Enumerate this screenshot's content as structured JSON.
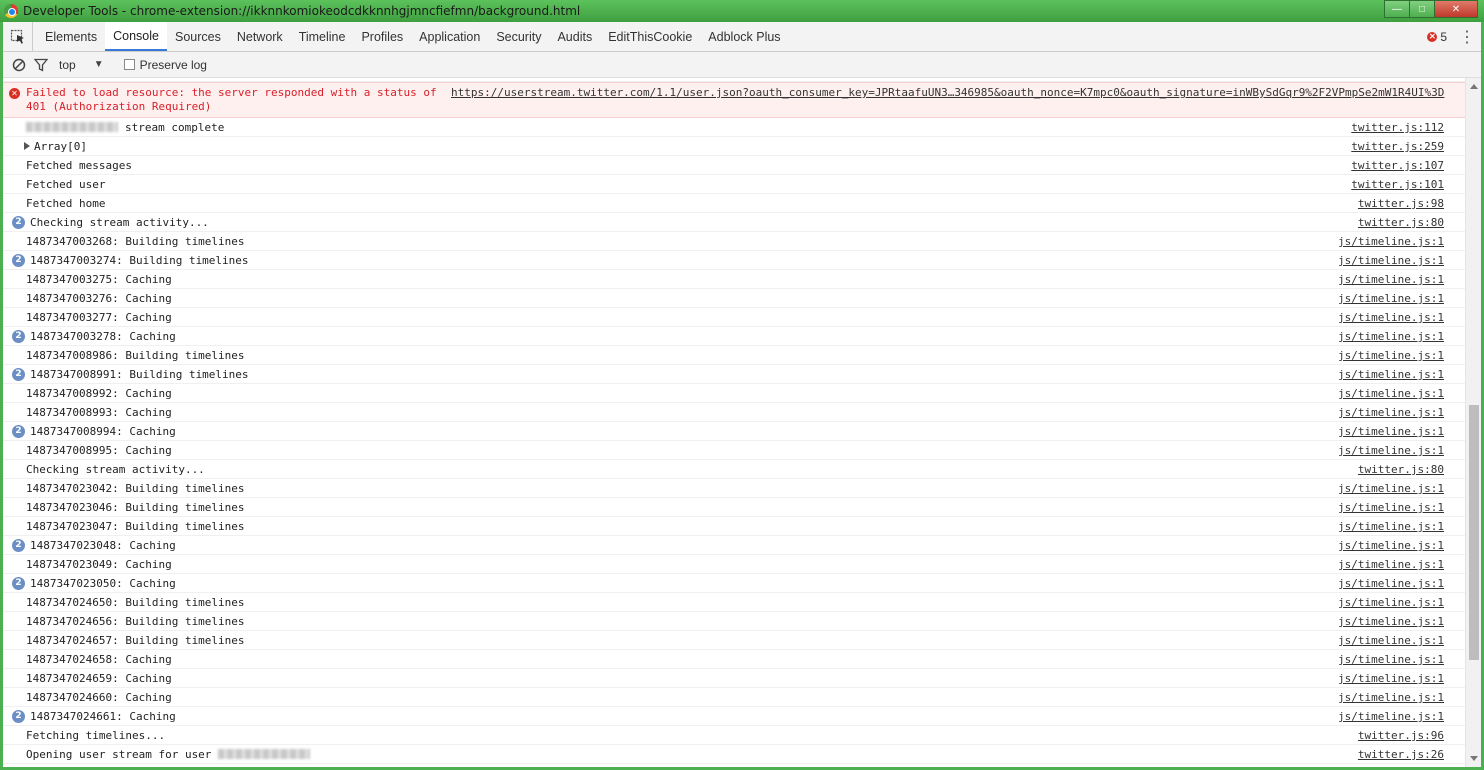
{
  "window": {
    "title": "Developer Tools - chrome-extension://ikknnkomiokeodcdkknnhgjmncfiefmn/background.html"
  },
  "tabs": [
    "Elements",
    "Console",
    "Sources",
    "Network",
    "Timeline",
    "Profiles",
    "Application",
    "Security",
    "Audits",
    "EditThisCookie",
    "Adblock Plus"
  ],
  "active_tab": "Console",
  "error_count": "5",
  "toolbar": {
    "context": "top",
    "preserve_log_label": "Preserve log",
    "preserve_log_checked": false
  },
  "console": {
    "error": {
      "message": "Failed to load resource: the server responded with a status of 401 (Authorization Required)",
      "url": "https://userstream.twitter.com/1.1/user.json?oauth_consumer_key=JPRtaafuUN3…346985&oauth_nonce=K7mpc0&oauth_signature=inWBySdGqr9%2F2VPmpSe2mW1R4UI%3D"
    },
    "rows": [
      {
        "text": "stream complete",
        "src": "twitter.js:112",
        "redacted_prefix": true
      },
      {
        "text": "Array[0]",
        "src": "twitter.js:259",
        "expandable": true
      },
      {
        "text": "Fetched messages",
        "src": "twitter.js:107"
      },
      {
        "text": "Fetched user",
        "src": "twitter.js:101"
      },
      {
        "text": "Fetched home",
        "src": "twitter.js:98"
      },
      {
        "text": "Checking stream activity...",
        "src": "twitter.js:80",
        "count": "2"
      },
      {
        "text": "1487347003268: Building timelines",
        "src": "js/timeline.js:1"
      },
      {
        "text": "1487347003274: Building timelines",
        "src": "js/timeline.js:1",
        "count": "2"
      },
      {
        "text": "1487347003275: Caching",
        "src": "js/timeline.js:1"
      },
      {
        "text": "1487347003276: Caching",
        "src": "js/timeline.js:1"
      },
      {
        "text": "1487347003277: Caching",
        "src": "js/timeline.js:1"
      },
      {
        "text": "1487347003278: Caching",
        "src": "js/timeline.js:1",
        "count": "2"
      },
      {
        "text": "1487347008986: Building timelines",
        "src": "js/timeline.js:1"
      },
      {
        "text": "1487347008991: Building timelines",
        "src": "js/timeline.js:1",
        "count": "2"
      },
      {
        "text": "1487347008992: Caching",
        "src": "js/timeline.js:1"
      },
      {
        "text": "1487347008993: Caching",
        "src": "js/timeline.js:1"
      },
      {
        "text": "1487347008994: Caching",
        "src": "js/timeline.js:1",
        "count": "2"
      },
      {
        "text": "1487347008995: Caching",
        "src": "js/timeline.js:1"
      },
      {
        "text": "Checking stream activity...",
        "src": "twitter.js:80"
      },
      {
        "text": "1487347023042: Building timelines",
        "src": "js/timeline.js:1"
      },
      {
        "text": "1487347023046: Building timelines",
        "src": "js/timeline.js:1"
      },
      {
        "text": "1487347023047: Building timelines",
        "src": "js/timeline.js:1"
      },
      {
        "text": "1487347023048: Caching",
        "src": "js/timeline.js:1",
        "count": "2"
      },
      {
        "text": "1487347023049: Caching",
        "src": "js/timeline.js:1"
      },
      {
        "text": "1487347023050: Caching",
        "src": "js/timeline.js:1",
        "count": "2"
      },
      {
        "text": "1487347024650: Building timelines",
        "src": "js/timeline.js:1"
      },
      {
        "text": "1487347024656: Building timelines",
        "src": "js/timeline.js:1"
      },
      {
        "text": "1487347024657: Building timelines",
        "src": "js/timeline.js:1"
      },
      {
        "text": "1487347024658: Caching",
        "src": "js/timeline.js:1"
      },
      {
        "text": "1487347024659: Caching",
        "src": "js/timeline.js:1"
      },
      {
        "text": "1487347024660: Caching",
        "src": "js/timeline.js:1"
      },
      {
        "text": "1487347024661: Caching",
        "src": "js/timeline.js:1",
        "count": "2"
      },
      {
        "text": "Fetching timelines...",
        "src": "twitter.js:96"
      },
      {
        "text": "Opening user stream for user",
        "src": "twitter.js:26",
        "redacted_suffix": true
      }
    ]
  },
  "colors": {
    "error_text": "#d8202a",
    "error_bg": "#fff0f0",
    "active_tab_underline": "#3879d9",
    "count_badge": "#6b8fc5",
    "window_frame": "#4caf50"
  }
}
